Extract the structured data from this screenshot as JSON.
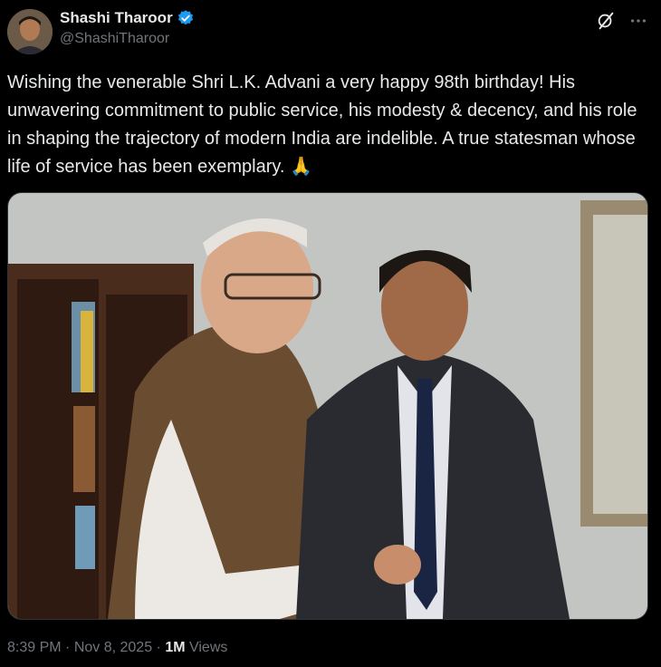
{
  "author": {
    "name": "Shashi Tharoor",
    "handle": "@ShashiTharoor",
    "verified_icon": "verified-badge-icon",
    "verified_color": "#1d9bf0"
  },
  "tweet": {
    "text": "Wishing the venerable Shri L.K. Advani a very happy 98th birthday! His unwavering commitment to public service, his modesty & decency, and his role in shaping the trajectory of modern India are indelible. A true statesman whose life of service has been exemplary. 🙏"
  },
  "meta": {
    "time": "8:39 PM",
    "sep1": " · ",
    "date": "Nov 8, 2025",
    "sep2": " · ",
    "views_count": "1M",
    "views_label": " Views"
  },
  "icons": {
    "grok": "grok-icon",
    "more": "more-options-icon"
  }
}
